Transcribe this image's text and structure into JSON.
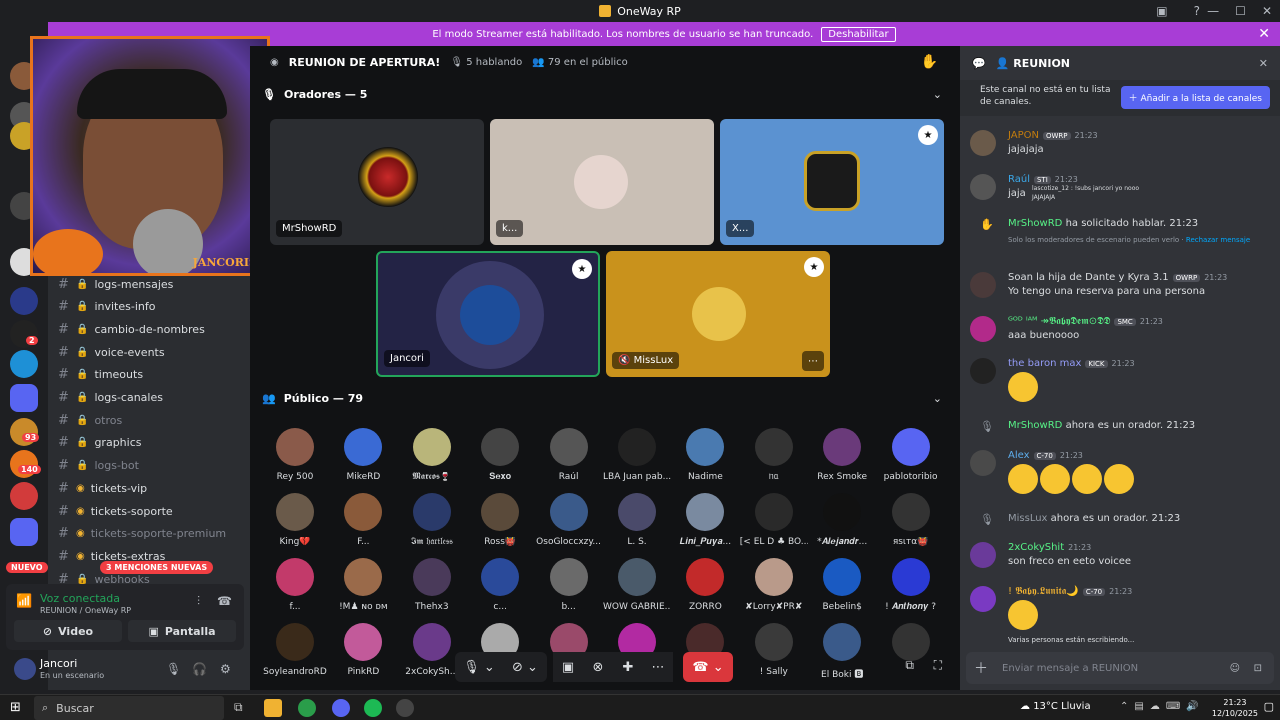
{
  "window": {
    "title": "OneWay RP",
    "min": "—",
    "max": "☐",
    "close": "✕"
  },
  "banner": {
    "text": "El modo Streamer está habilitado. Los nombres de usuario se han truncado.",
    "button": "Deshabilitar",
    "close": "✕"
  },
  "guild_badges": {
    "a": "2",
    "b": "93",
    "c": "140"
  },
  "camera": {
    "overlay_name": "JANCORIS"
  },
  "channels": [
    {
      "label": "logs-mensajes",
      "dim": false
    },
    {
      "label": "invites-info",
      "dim": false
    },
    {
      "label": "cambio-de-nombres",
      "dim": false
    },
    {
      "label": "voice-events",
      "dim": false
    },
    {
      "label": "timeouts",
      "dim": false
    },
    {
      "label": "logs-canales",
      "dim": false
    },
    {
      "label": "otros",
      "dim": true
    },
    {
      "label": "graphics",
      "dim": false
    },
    {
      "label": "logs-bot",
      "dim": true
    },
    {
      "label": "tickets-vip",
      "dim": false
    },
    {
      "label": "tickets-soporte",
      "dim": false
    },
    {
      "label": "tickets-soporte-premium",
      "dim": true
    },
    {
      "label": "tickets-extras",
      "dim": false
    },
    {
      "label": "webhooks",
      "dim": true
    }
  ],
  "sidebar": {
    "new_badge": "NUEVO",
    "mentions": "3 MENCIONES NUEVAS"
  },
  "voice": {
    "status": "Voz conectada",
    "channel": "REUNION",
    "server": "/ OneWay RP",
    "video": "Video",
    "screen": "Pantalla"
  },
  "user": {
    "name": "Jancori",
    "status": "En un escenario"
  },
  "stage": {
    "title": "REUNION DE APERTURA!",
    "speaking": "5 hablando",
    "audience": "79 en el público",
    "speakers_header": "Oradores — 5",
    "public_header": "Público — 79",
    "speakers": [
      "MrShowRD",
      "k...",
      "X...",
      "Jancori",
      "MissLux"
    ],
    "public": [
      "Rey 500",
      "MikeRD",
      "𝕸𝖆𝖗𝖈𝖔𝖘🍷",
      "𝐒𝐞𝐱𝐨",
      "Raúl",
      "LBA Juan pab...",
      "Nadime",
      "ᥒᥲ",
      "Rex Smoke",
      "pablotoribio",
      "King💔",
      "F...",
      "𝕴𝖒 𝔥𝔞𝔯𝔱𝔩𝔢𝔰𝔰",
      "Ross👹",
      "OsoGloccxzy...",
      "L. S.",
      "𝑳𝒊𝒏𝒊_𝑷𝒖𝒚𝒂...",
      "[< EL D ♣ BO...",
      "*𝑨𝒍𝒆𝒋𝒂𝒏𝒅𝒓...",
      "яѕιтα👹",
      "f...",
      "!M♟ ɴᴏ ᴅᴍ",
      "Thehx3",
      "c...",
      "b...",
      "WOW GABRIE...",
      "ZORRO",
      "✘Lorry✘PR✘",
      "Bebelin$",
      "! 𝑨𝒏𝒕𝒉𝒐𝒏𝒚 ?",
      "SoyleandroRD",
      "PinkRD",
      "2xCokySh...",
      "",
      "",
      "",
      "",
      "! Sally",
      "El Boki 🅱",
      ""
    ]
  },
  "chat": {
    "channel": "REUNION",
    "notice": "Este canal no está en tu lista de canales.",
    "add_button": "Añadir a la lista de canales",
    "messages": [
      {
        "user": "JAPON",
        "tag": "OWRP",
        "time": "21:23",
        "text": "jajajaja",
        "color": "#c27c0e"
      },
      {
        "user": "Raúl",
        "tag": "STI",
        "time": "21:23",
        "text": "jaja",
        "color": "#3ba8e8",
        "reply": "lascotize_12 : !subs jancori yo nooo",
        "reply2": "JAJAJAJA"
      },
      {
        "user": "Soan la hija de Dante y Kyra 3.1",
        "tag": "OWRP",
        "time": "21:23",
        "text": "Yo tengo una reserva para una persona",
        "color": "#dbdee1"
      },
      {
        "user": "ᴳᴼᴰ ᴵᴬᴹ ↠𝕭𝖆𝖇𝖞𝕯𝖊𝖒⊙𝕯𝕯",
        "tag": "SMC",
        "time": "21:23",
        "text": "aaa buenoooo",
        "color": "#57f287"
      },
      {
        "user": "the baron max",
        "tag": "KICK",
        "time": "21:23",
        "text": "",
        "color": "#949cf7"
      },
      {
        "user": "Alex",
        "tag": "C-70",
        "time": "21:23",
        "text": "",
        "color": "#5dadec"
      },
      {
        "user": "2xCokyShit",
        "tag": "",
        "time": "21:23",
        "text": "son freco en eeto voicee",
        "color": "#57f287"
      },
      {
        "user": "! 𝕭𝖆𝖇𝖞.𝕷𝖚𝖓𝖎𝖙𝖆🌙",
        "tag": "C-70",
        "time": "21:23",
        "text": "",
        "color": "#f0b232"
      }
    ],
    "request": {
      "user": "MrShowRD",
      "text": "ha solicitado hablar.",
      "time": "21:23",
      "note": "Solo los moderadores de escenario pueden verlo ·",
      "reject": "Rechazar mensaje"
    },
    "system1": {
      "user": "MrShowRD",
      "text": "ahora es un orador.",
      "time": "21:23"
    },
    "system2": {
      "user": "MissLux",
      "text": "ahora es un orador.",
      "time": "21:23"
    },
    "typing": "Varias personas están escribiendo...",
    "input_placeholder": "Enviar mensaje a  REUNION"
  },
  "taskbar": {
    "search": "Buscar",
    "weather": "13°C  Lluvia",
    "time": "21:23",
    "date": "12/10/2025"
  },
  "colors": {
    "banner": "#a83dd6",
    "accent": "#5865f2",
    "speaking": "#23a55a",
    "hangup": "#da373c"
  }
}
